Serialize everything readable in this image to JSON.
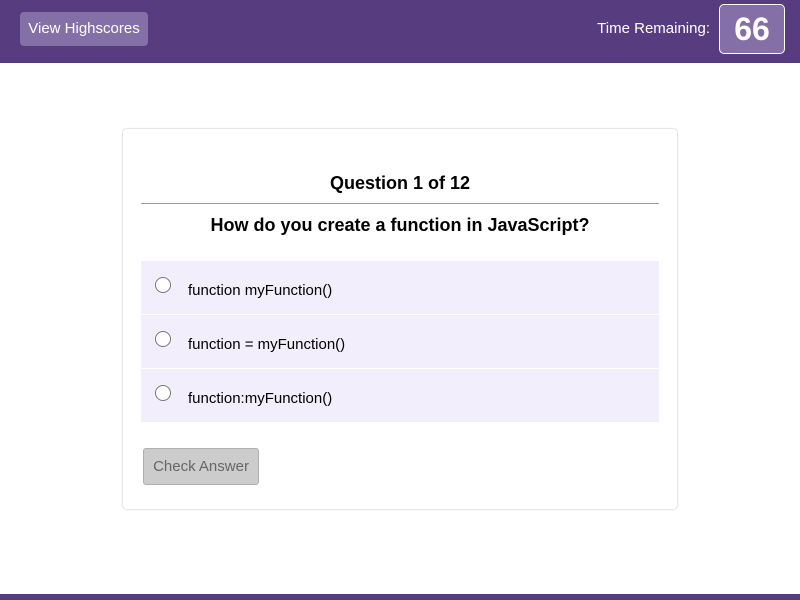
{
  "header": {
    "highscores_label": "View Highscores",
    "time_label": "Time Remaining:",
    "time_value": "66"
  },
  "quiz": {
    "question_count": "Question 1 of 12",
    "question_text": "How do you create a function in JavaScript?",
    "options": [
      {
        "label": "function myFunction()",
        "selected": false
      },
      {
        "label": "function = myFunction()",
        "selected": false
      },
      {
        "label": "function:myFunction()",
        "selected": false
      }
    ],
    "check_label": "Check Answer",
    "check_disabled": true
  },
  "colors": {
    "header_bg": "#573d7f",
    "button_bg": "#8470a6",
    "option_bg": "#f3eefc"
  }
}
